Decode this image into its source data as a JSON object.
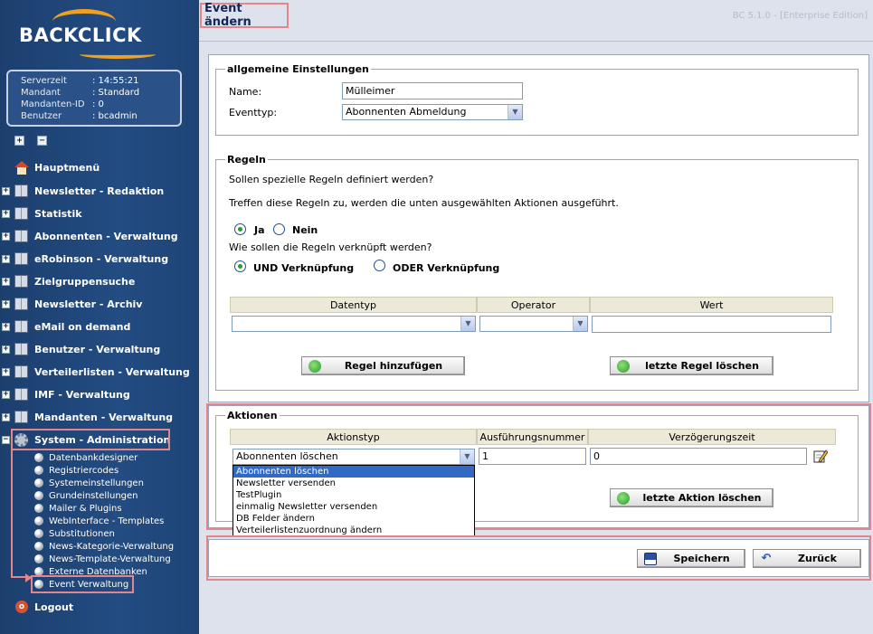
{
  "app": {
    "logo": "BACKCLICK",
    "version": "BC 5.1.0 - [Enterprise Edition]",
    "page_title": "Event ändern"
  },
  "server_info": [
    {
      "key": "Serverzeit",
      "value": ": 14:55:21"
    },
    {
      "key": "Mandant",
      "value": ": Standard"
    },
    {
      "key": "Mandanten-ID",
      "value": ": 0"
    },
    {
      "key": "Benutzer",
      "value": ": bcadmin"
    }
  ],
  "tree_controls": {
    "expand": "+",
    "collapse": "−"
  },
  "nav": {
    "home": "Hauptmenü",
    "items": [
      "Newsletter - Redaktion",
      "Statistik",
      "Abonnenten - Verwaltung",
      "eRobinson - Verwaltung",
      "Zielgruppensuche",
      "Newsletter - Archiv",
      "eMail on demand",
      "Benutzer - Verwaltung",
      "Verteilerlisten - Verwaltung",
      "IMF - Verwaltung",
      "Mandanten - Verwaltung",
      "System - Administration"
    ],
    "sub_items": [
      "Datenbankdesigner",
      "Registriercodes",
      "Systemeinstellungen",
      "Grundeinstellungen",
      "Mailer & Plugins",
      "WebInterface - Templates",
      "Substitutionen",
      "News-Kategorie-Verwaltung",
      "News-Template-Verwaltung",
      "Externe Datenbanken",
      "Event Verwaltung"
    ],
    "logout": "Logout",
    "plus": "+",
    "minus": "−",
    "logout_glyph": "o"
  },
  "general": {
    "legend": "allgemeine Einstellungen",
    "name_label": "Name:",
    "name_value": "Mülleimer",
    "type_label": "Eventtyp:",
    "type_value": "Abonnenten Abmeldung"
  },
  "rules": {
    "legend": "Regeln",
    "question": "Sollen spezielle Regeln definiert werden?",
    "info": "Treffen diese Regeln zu, werden die unten ausgewählten Aktionen ausgeführt.",
    "yes": "Ja",
    "no": "Nein",
    "link_question": "Wie sollen die Regeln verknüpft werden?",
    "and_link": "UND Verknüpfung",
    "or_link": "ODER Verknüpfung",
    "columns": [
      "Datentyp",
      "Operator",
      "Wert"
    ],
    "add_button": "Regel hinzufügen",
    "delete_button": "letzte Regel löschen"
  },
  "actions": {
    "legend": "Aktionen",
    "columns": [
      "Aktionstyp",
      "Ausführungsnummer",
      "Verzögerungszeit"
    ],
    "type_value": "Abonnenten löschen",
    "number_value": "1",
    "delay_value": "0",
    "delete_button": "letzte Aktion löschen",
    "dropdown_options": [
      "Abonnenten löschen",
      "Newsletter versenden",
      "TestPlugin",
      "einmalig Newsletter versenden",
      "DB Felder ändern",
      "Verteilerlistenzuordnung ändern"
    ]
  },
  "footer": {
    "save_button": "Speichern",
    "back_button": "Zurück"
  },
  "icons": {
    "dropdown_arrow": "▼",
    "back_arrow": "↶"
  },
  "colors": {
    "sidebar": "#234c82",
    "highlight": "#e0868c",
    "selection": "#316ac5",
    "logo_accent": "#f0a020"
  }
}
